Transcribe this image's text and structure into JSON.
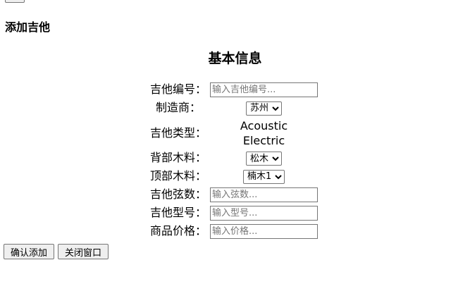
{
  "page": {
    "heading": "添加吉他"
  },
  "form": {
    "section_title": "基本信息",
    "fields": {
      "guitar_id": {
        "label": "吉他编号：",
        "placeholder": "输入吉他编号..."
      },
      "manufacturer": {
        "label": "制造商：",
        "selected": "苏州"
      },
      "guitar_type": {
        "label": "吉他类型：",
        "options": [
          "Acoustic",
          "Electric"
        ]
      },
      "back_wood": {
        "label": "背部木料：",
        "selected": "松木"
      },
      "top_wood": {
        "label": "顶部木料：",
        "selected": "楠木1"
      },
      "strings": {
        "label": "吉他弦数：",
        "placeholder": "输入弦数..."
      },
      "model": {
        "label": "吉他型号：",
        "placeholder": "输入型号..."
      },
      "price": {
        "label": "商品价格：",
        "placeholder": "输入价格..."
      }
    }
  },
  "actions": {
    "confirm_label": "确认添加",
    "close_label": "关闭窗口"
  }
}
